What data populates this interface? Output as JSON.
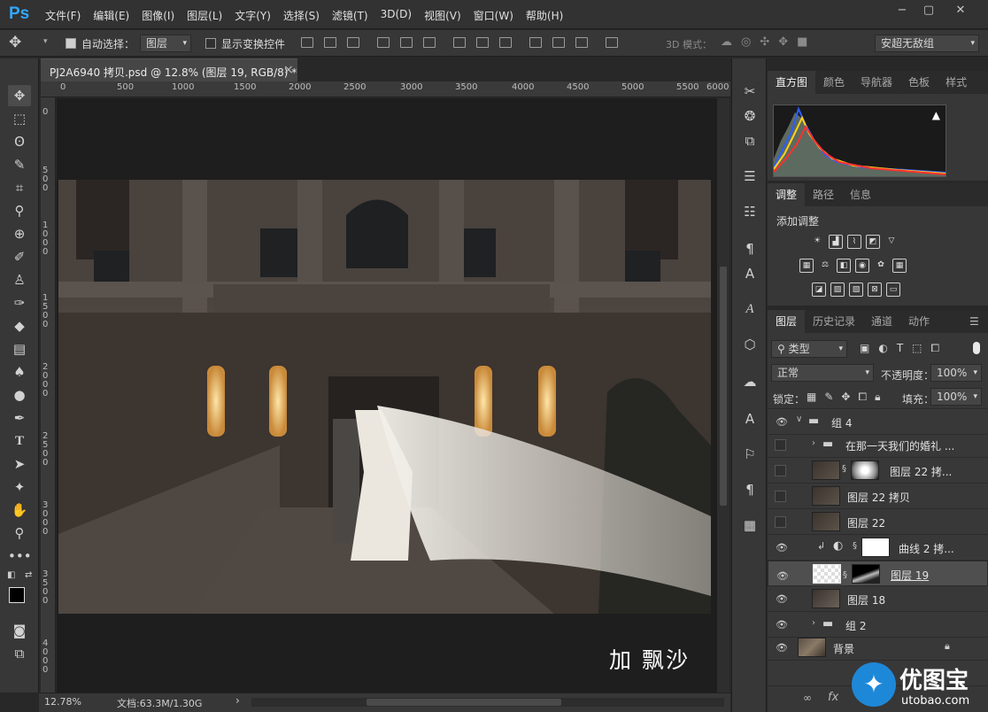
{
  "app": {
    "logo": "Ps"
  },
  "menu": [
    "文件(F)",
    "编辑(E)",
    "图像(I)",
    "图层(L)",
    "文字(Y)",
    "选择(S)",
    "滤镜(T)",
    "3D(D)",
    "视图(V)",
    "窗口(W)",
    "帮助(H)"
  ],
  "window_controls": {
    "minimize": "−",
    "restore": "▢",
    "close": "✕"
  },
  "options": {
    "auto_select_label": "自动选择：",
    "auto_select_target": "图层",
    "show_transform": "显示变换控件",
    "mode_3d": "3D 模式：",
    "workspace": "安超无敌组"
  },
  "document": {
    "tab_title": "PJ2A6940 拷贝.psd @ 12.8% (图层 19, RGB/8) *",
    "tab_close": "×",
    "overlay_text": "加 飘沙"
  },
  "ruler": {
    "h_labels": [
      "0",
      "500",
      "1000",
      "1500",
      "2000",
      "2500",
      "3000",
      "3500",
      "4000",
      "4500",
      "5000",
      "5500",
      "6000"
    ],
    "v_labels": [
      "0",
      "5 0 0",
      "1 0 0 0",
      "1 5 0 0",
      "2 0 0 0",
      "2 5 0 0",
      "3 0 0 0",
      "3 5 0 0",
      "4 0 0 0"
    ]
  },
  "status": {
    "zoom": "12.78%",
    "doc_size": "文档:63.3M/1.30G"
  },
  "panels": {
    "top_tabs": [
      "直方图",
      "颜色",
      "导航器",
      "色板",
      "样式"
    ],
    "adjust_tabs": [
      "调整",
      "路径",
      "信息"
    ],
    "adjust_title": "添加调整",
    "layers_tabs": [
      "图层",
      "历史记录",
      "通道",
      "动作"
    ],
    "filter_kind": "类型",
    "blend_mode": "正常",
    "opacity_label": "不透明度：",
    "opacity_value": "100%",
    "lock_label": "锁定：",
    "fill_label": "填充：",
    "fill_value": "100%"
  },
  "layers": [
    {
      "name": "组 4",
      "visible": true,
      "type": "group",
      "expanded": true,
      "indent": 0
    },
    {
      "name": "在那一天我们的婚礼 ...",
      "visible": false,
      "type": "group",
      "expanded": false,
      "indent": 1
    },
    {
      "name": "图层 22 拷...",
      "visible": false,
      "type": "masked",
      "indent": 1
    },
    {
      "name": "图层 22 拷贝",
      "visible": false,
      "type": "pixel",
      "indent": 1
    },
    {
      "name": "图层 22",
      "visible": false,
      "type": "pixel",
      "indent": 1
    },
    {
      "name": "曲线 2 拷...",
      "visible": true,
      "type": "adjustment",
      "indent": 1
    },
    {
      "name": "图层 19",
      "visible": true,
      "type": "masked",
      "selected": true,
      "indent": 1
    },
    {
      "name": "图层 18",
      "visible": true,
      "type": "pixel",
      "indent": 1
    },
    {
      "name": "组 2",
      "visible": true,
      "type": "group",
      "expanded": false,
      "indent": 0
    },
    {
      "name": "背景",
      "visible": true,
      "type": "background",
      "locked": true,
      "indent": 0
    }
  ],
  "layer_footer": [
    "∞",
    "fx"
  ],
  "watermark": {
    "brand": "优图宝",
    "url": "utobao.com"
  }
}
